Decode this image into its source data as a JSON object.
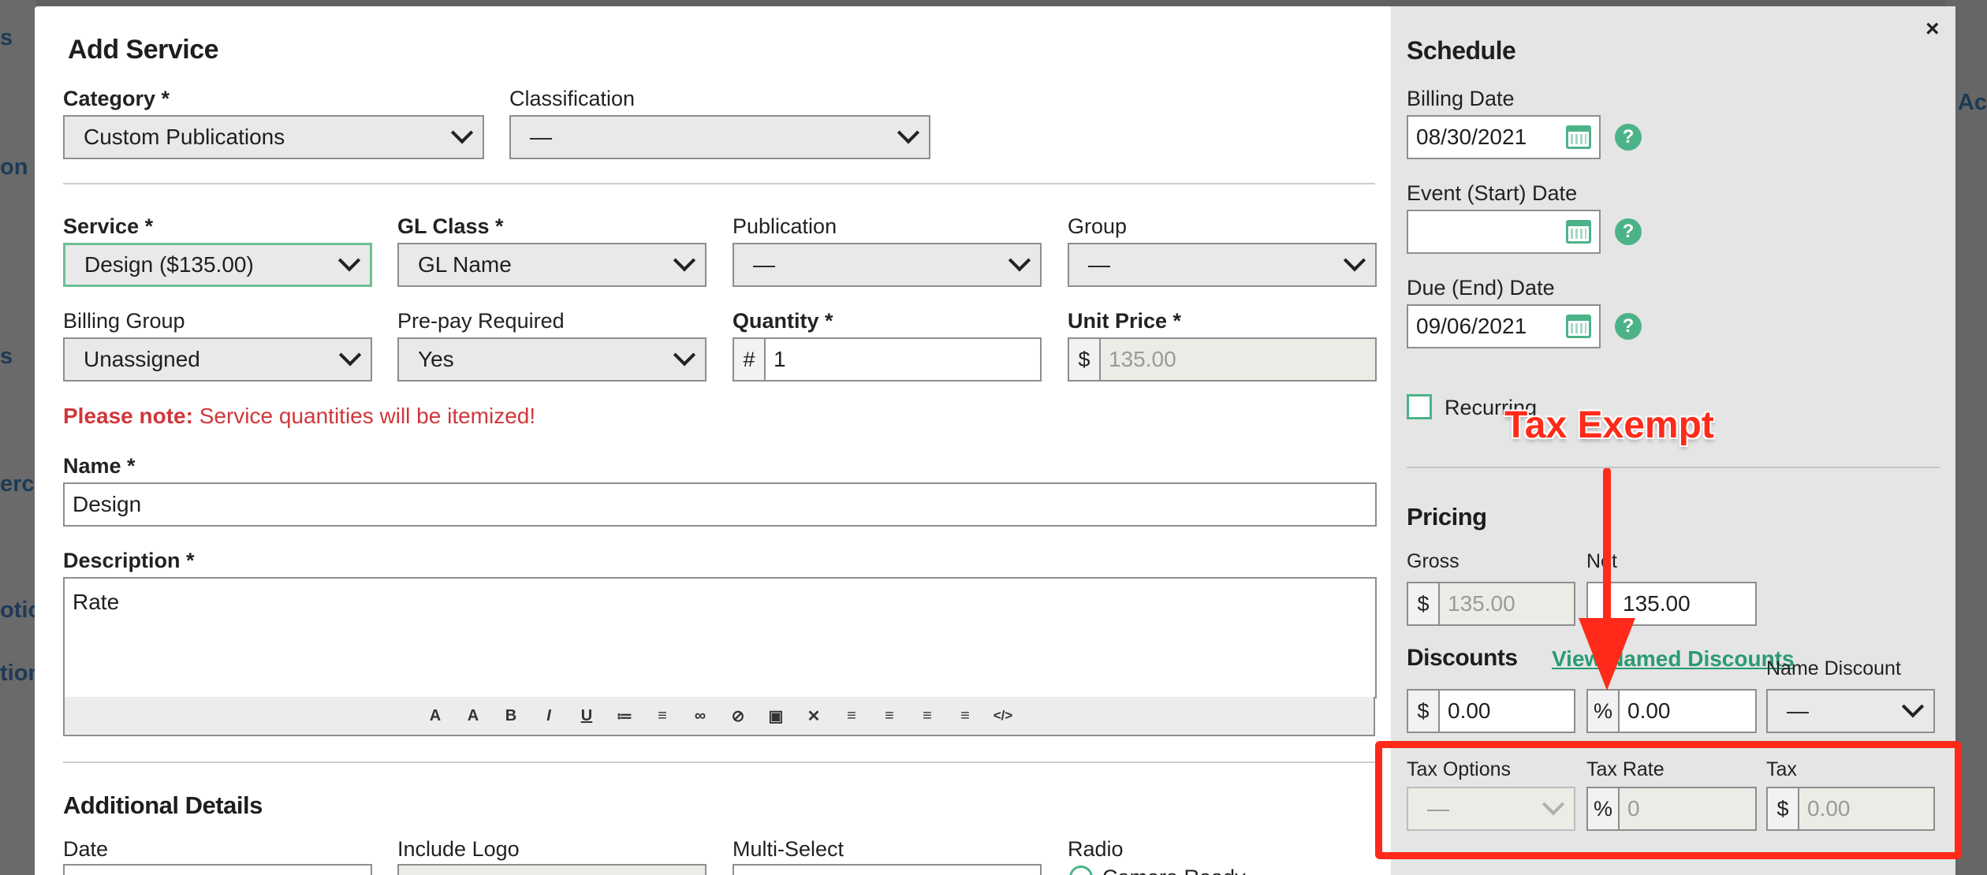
{
  "background": {
    "left_fragments": [
      "s",
      "on",
      "s",
      "erce",
      "otio",
      "tion"
    ],
    "right_fragment": "Ac"
  },
  "modal": {
    "title": "Add Service",
    "close_glyph": "×",
    "category": {
      "label": "Category *",
      "value": "Custom Publications"
    },
    "classification": {
      "label": "Classification",
      "value": "—"
    },
    "service": {
      "label": "Service *",
      "value": "Design ($135.00)"
    },
    "gl_class": {
      "label": "GL Class *",
      "value": "GL Name"
    },
    "publication": {
      "label": "Publication",
      "value": "—"
    },
    "group": {
      "label": "Group",
      "value": "—"
    },
    "billing_group": {
      "label": "Billing Group",
      "value": "Unassigned"
    },
    "prepay": {
      "label": "Pre-pay Required",
      "value": "Yes"
    },
    "quantity": {
      "label": "Quantity *",
      "addon": "#",
      "value": "1"
    },
    "unit_price": {
      "label": "Unit Price *",
      "addon": "$",
      "value": "135.00"
    },
    "note": {
      "strong": "Please note:",
      "text": " Service quantities will be itemized!"
    },
    "name": {
      "label": "Name *",
      "value": "Design"
    },
    "description": {
      "label": "Description *",
      "value": "Rate"
    },
    "toolbar_icons": [
      "font-size-down-icon",
      "font-size-up-icon",
      "bold-icon",
      "italic-icon",
      "underline-icon",
      "bullet-list-icon",
      "numbered-list-icon",
      "link-icon",
      "unlink-icon",
      "image-icon",
      "clear-format-icon",
      "align-left-icon",
      "align-center-icon",
      "align-right-icon",
      "justify-icon",
      "code-icon"
    ],
    "toolbar_glyphs": [
      "A",
      "A",
      "B",
      "I",
      "U",
      "≔",
      "≡",
      "∞",
      "⊘",
      "▣",
      "✕",
      "≡",
      "≡",
      "≡",
      "≡",
      "</>"
    ],
    "additional": {
      "title": "Additional Details",
      "date_label": "Date",
      "logo_label": "Include Logo",
      "multiselect_label": "Multi-Select",
      "radio_label": "Radio",
      "radio_option": "Camera Ready"
    }
  },
  "schedule": {
    "title": "Schedule",
    "billing_date": {
      "label": "Billing Date",
      "value": "08/30/2021"
    },
    "event_date": {
      "label": "Event (Start) Date",
      "value": ""
    },
    "due_date": {
      "label": "Due (End) Date",
      "value": "09/06/2021"
    },
    "help_glyph": "?",
    "recurring_label": "Recurring",
    "pricing": {
      "title": "Pricing",
      "gross_label": "Gross",
      "gross_addon": "$",
      "gross_value": "135.00",
      "net_label": "Net",
      "net_value": "135.00"
    },
    "discounts": {
      "title": "Discounts",
      "link": "View Named Discounts",
      "amount_addon": "$",
      "amount_value": "0.00",
      "percent_addon": "%",
      "percent_value": "0.00",
      "name_label": "Name Discount",
      "name_value": "—"
    },
    "tax": {
      "options_label": "Tax Options",
      "options_value": "—",
      "rate_label": "Tax Rate",
      "rate_addon": "%",
      "rate_value": "0",
      "tax_label": "Tax",
      "tax_addon": "$",
      "tax_value": "0.00"
    }
  },
  "annotation": {
    "text": "Tax Exempt",
    "color": "#ff2a1a"
  },
  "colors": {
    "accent": "#4cb389",
    "note_red": "#d0373b",
    "panel_bg": "#e5e5e5"
  }
}
